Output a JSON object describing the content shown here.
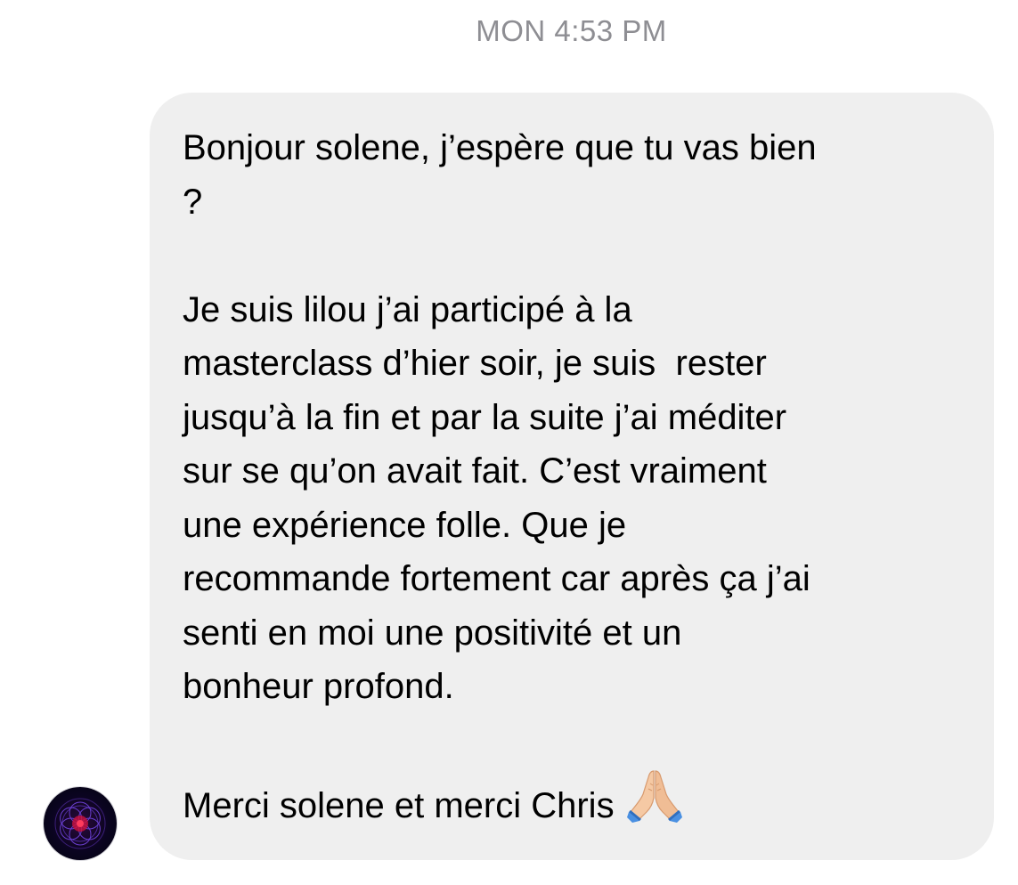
{
  "conversation": {
    "timestamp": "MON 4:53 PM"
  },
  "message": {
    "lines": [
      "Bonjour solene, j’espère que tu vas bien",
      "?",
      "",
      "Je suis lilou j’ai participé à la",
      "masterclass d’hier soir, je suis  rester",
      "jusqu’à la fin et par la suite j’ai méditer",
      "sur se qu’on avait fait. C’est vraiment",
      "une expérience folle. Que je",
      "recommande fortement car après ça j’ai",
      "senti en moi une positivité et un",
      "bonheur profond.",
      ""
    ],
    "closing": "Merci solene et merci Chris",
    "closing_emoji": "folded-hands-emoji",
    "bubble_color": "#efefef"
  },
  "sender": {
    "avatar_icon": "mandala-avatar-icon"
  }
}
